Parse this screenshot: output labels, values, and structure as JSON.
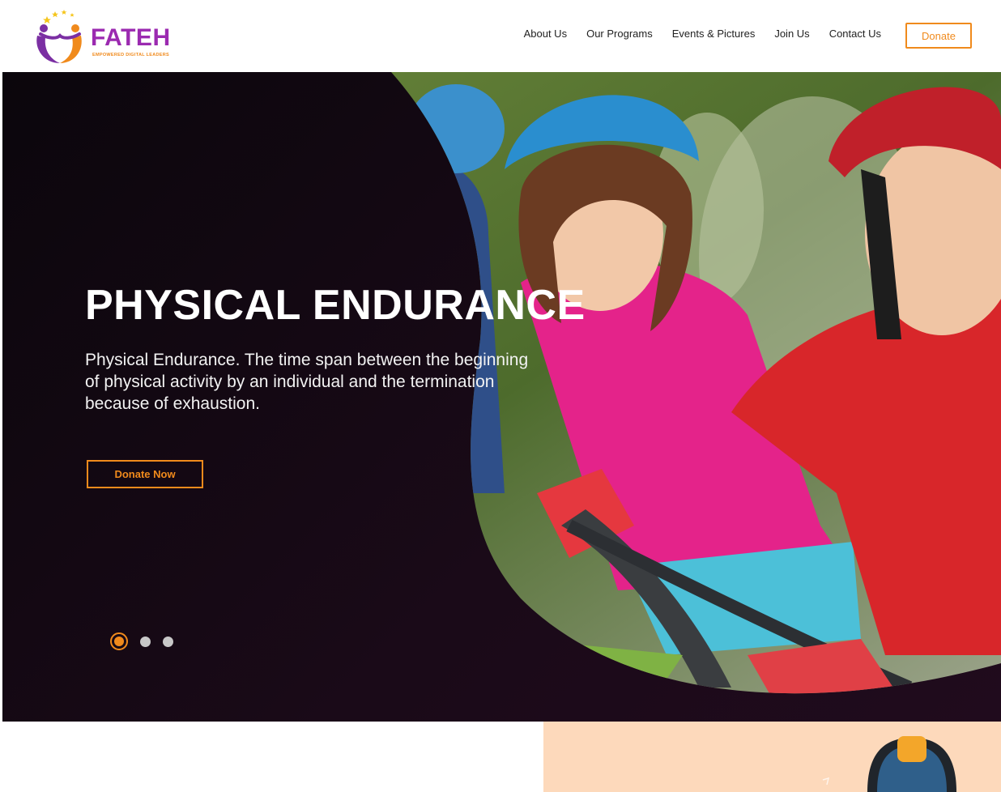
{
  "brand": {
    "name": "FATEH",
    "tagline": "EMPOWERED DIGITAL LEADERS",
    "colors": {
      "primary": "#9b2ab0",
      "accent": "#f08a1c"
    }
  },
  "nav": {
    "items": [
      {
        "label": "About Us"
      },
      {
        "label": "Our Programs"
      },
      {
        "label": "Events & Pictures"
      },
      {
        "label": "Join Us"
      },
      {
        "label": "Contact Us"
      }
    ],
    "donate_label": "Donate"
  },
  "hero": {
    "title": "PHYSICAL ENDURANCE",
    "description": "Physical Endurance. The time span between the beginning of physical activity by an individual and the termination because of exhaustion.",
    "cta_label": "Donate Now",
    "slides": {
      "count": 3,
      "active": 1
    }
  }
}
